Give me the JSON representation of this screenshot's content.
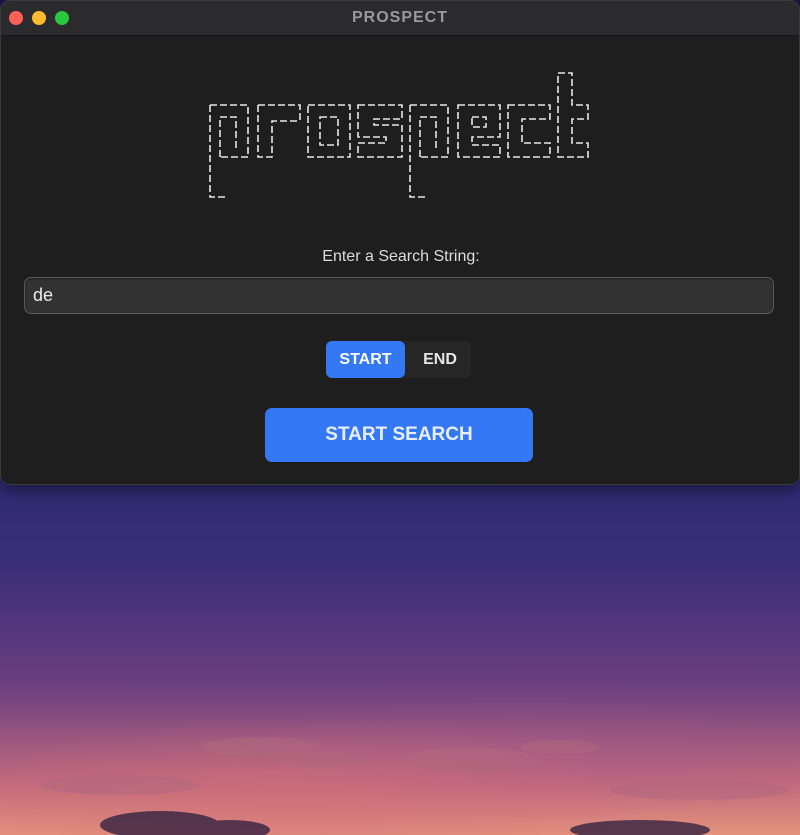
{
  "window": {
    "title": "PROSPECT"
  },
  "logo": {
    "text": "prospect"
  },
  "search": {
    "prompt": "Enter a Search String:",
    "value": "de",
    "placeholder": ""
  },
  "position_toggle": {
    "options": [
      "START",
      "END"
    ],
    "selected": "START"
  },
  "actions": {
    "start_search_label": "START SEARCH"
  },
  "colors": {
    "accent": "#3478f6",
    "window_bg": "#1e1e1f",
    "close": "#fe5f57",
    "minimize": "#febc2e",
    "maximize": "#28c840"
  },
  "icons": [
    "close-button",
    "minimize-button",
    "maximize-button"
  ]
}
